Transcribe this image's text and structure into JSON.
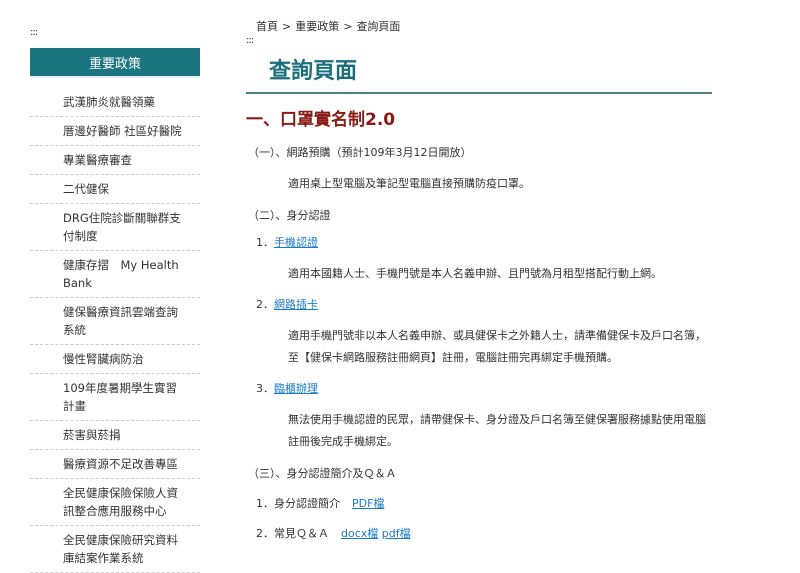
{
  "sidebar": {
    "accesskey": ":::",
    "header": "重要政策",
    "items": [
      {
        "label": "武漢肺炎就醫領藥"
      },
      {
        "label": "厝邊好醫師 社區好醫院"
      },
      {
        "label": "專業醫療審查"
      },
      {
        "label": "二代健保"
      },
      {
        "label": "DRG住院診斷關聯群支付制度"
      },
      {
        "label": "健康存摺　My Health Bank"
      },
      {
        "label": "健保醫療資訊雲端查詢系統"
      },
      {
        "label": "慢性腎臟病防治"
      },
      {
        "label": "109年度暑期學生實習計畫"
      },
      {
        "label": "菸害與菸捐"
      },
      {
        "label": "醫療資源不足改善專區"
      },
      {
        "label": "全民健康保險保險人資訊整合應用服務中心"
      },
      {
        "label": "全民健康保險研究資料庫結案作業系統"
      }
    ]
  },
  "breadcrumb": {
    "items": [
      "首頁",
      "重要政策",
      "查詢頁面"
    ],
    "separator": ">"
  },
  "main": {
    "accesskey": ":::",
    "page_title": "查詢頁面",
    "section_title": "一、口罩實名制2.0",
    "sub1": {
      "heading": "（一）、網路預購（預計109年3月12日開放）",
      "text": "適用桌上型電腦及筆記型電腦直接預購防疫口罩。"
    },
    "sub2": {
      "heading": "（二）、身分認證",
      "items": [
        {
          "prefix": "1．",
          "link": "手機認證",
          "text": "適用本國籍人士、手機門號是本人名義申辦、且門號為月租型搭配行動上網。"
        },
        {
          "prefix": "2．",
          "link": "網路插卡",
          "text": "適用手機門號非以本人名義申辦、或具健保卡之外籍人士，請準備健保卡及戶口名簿，至【健保卡網路服務註冊網頁】註冊，電腦註冊完再綁定手機預購。"
        },
        {
          "prefix": "3．",
          "link": "臨櫃辦理",
          "text": "無法使用手機認證的民眾，請帶健保卡、身分證及戶口名簿至健保署服務據點使用電腦註冊後完成手機綁定。"
        }
      ]
    },
    "sub3": {
      "heading": "（三）、身分認證簡介及Ｑ＆Ａ",
      "items": [
        {
          "prefix": "1．",
          "label": "身分認證簡介",
          "links": [
            "PDF檔"
          ]
        },
        {
          "prefix": "2．",
          "label": "常見Ｑ＆Ａ",
          "links": [
            "docx檔",
            "pdf檔"
          ]
        }
      ]
    }
  },
  "colors": {
    "sidebar_header_bg": "#1b7580",
    "page_title": "#1b6f7d",
    "section_title": "#8b1a14",
    "link": "#1a7acb"
  }
}
